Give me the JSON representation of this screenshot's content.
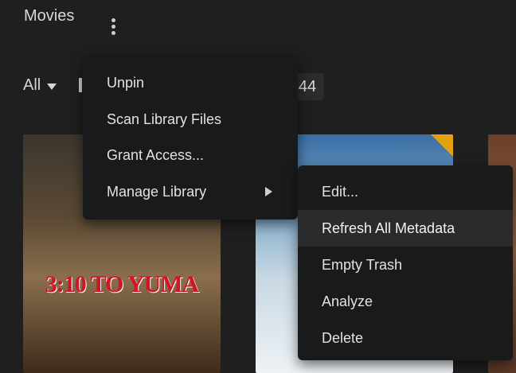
{
  "header": {
    "title": "Movies"
  },
  "filters": {
    "type_label": "All",
    "count": "44"
  },
  "posters": [
    {
      "title_art": "3:10 TO YUMA"
    }
  ],
  "library_menu": {
    "items": [
      {
        "label": "Unpin"
      },
      {
        "label": "Scan Library Files"
      },
      {
        "label": "Grant Access..."
      },
      {
        "label": "Manage Library"
      }
    ]
  },
  "manage_submenu": {
    "items": [
      {
        "label": "Edit..."
      },
      {
        "label": "Refresh All Metadata"
      },
      {
        "label": "Empty Trash"
      },
      {
        "label": "Analyze"
      },
      {
        "label": "Delete"
      }
    ],
    "highlighted": "Refresh All Metadata"
  },
  "colors": {
    "background": "#1f1f1f",
    "menu_bg": "#191a1b",
    "accent_badge": "#e5a00d"
  },
  "icons": {
    "more_menu": "kebab-icon",
    "dropdown": "caret-down-icon",
    "submenu": "chevron-right-icon"
  }
}
